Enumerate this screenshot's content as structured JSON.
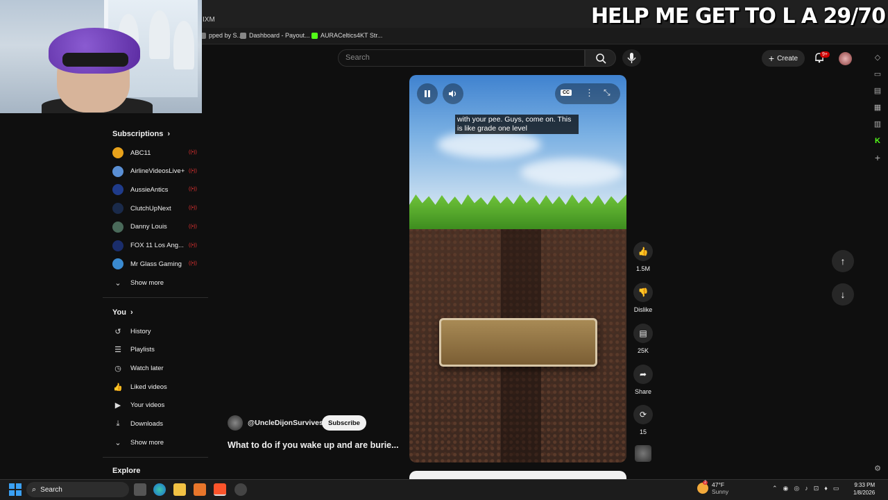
{
  "browser": {
    "tab_title": "IXM",
    "bookmarks": [
      {
        "label": "pped by S...",
        "color": "#7a7a7a"
      },
      {
        "label": "Dashboard - Payout...",
        "color": "#888888"
      },
      {
        "label": "AURACeltics4KT Str...",
        "color": "#53fc18"
      }
    ]
  },
  "stream_overlay": {
    "text": "HELP ME GET TO L A 29/70"
  },
  "topbar": {
    "search_placeholder": "Search",
    "create_label": "Create",
    "notification_count": "9+"
  },
  "sidebar": {
    "subscriptions_heading": "Subscriptions",
    "channels": [
      {
        "label": "ABC11",
        "color": "#e8a21b"
      },
      {
        "label": "AirlineVideosLive+",
        "color": "#5a8fd4"
      },
      {
        "label": "AussieAntics",
        "color": "#1f3b8a"
      },
      {
        "label": "ClutchUpNext",
        "color": "#1a2a4a"
      },
      {
        "label": "Danny Louis",
        "color": "#4a6a5a"
      },
      {
        "label": "FOX 11 Los Ang...",
        "color": "#1a2d6b"
      },
      {
        "label": "Mr Glass Gaming",
        "color": "#3a8ad0"
      }
    ],
    "subs_show_more": "Show more",
    "you_heading": "You",
    "you_items": [
      {
        "label": "History",
        "icon": "history-icon",
        "glyph": "↺"
      },
      {
        "label": "Playlists",
        "icon": "playlists-icon",
        "glyph": "☰"
      },
      {
        "label": "Watch later",
        "icon": "clock-icon",
        "glyph": "◷"
      },
      {
        "label": "Liked videos",
        "icon": "thumbs-up-icon",
        "glyph": "👍"
      },
      {
        "label": "Your videos",
        "icon": "video-icon",
        "glyph": "▶"
      },
      {
        "label": "Downloads",
        "icon": "download-icon",
        "glyph": "⤓"
      }
    ],
    "you_show_more": "Show more",
    "explore_heading": "Explore"
  },
  "video": {
    "caption": "with your pee. Guys, come on. This is like grade one level",
    "cc_label": "CC"
  },
  "actions": {
    "likes": "1.5M",
    "dislike_label": "Dislike",
    "comments": "25K",
    "share_label": "Share",
    "remix_count": "15"
  },
  "channel": {
    "handle": "@UncleDijonSurvives",
    "subscribe_label": "Subscribe",
    "video_title": "What to do if you wake up and are burie..."
  },
  "taskbar": {
    "search_label": "Search",
    "weather_temp": "47°F",
    "weather_desc": "Sunny",
    "weather_badge": "2",
    "time": "9:33 PM",
    "date": "1/8/2026"
  }
}
